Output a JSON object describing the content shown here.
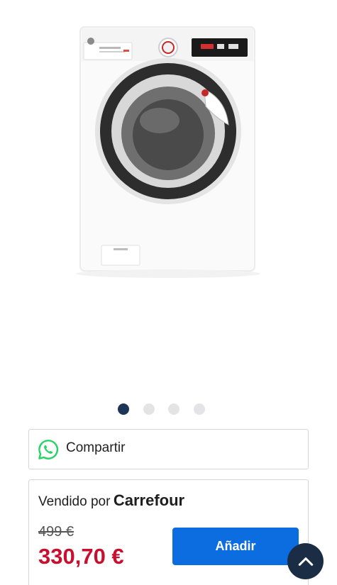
{
  "gallery": {
    "total_images": 4,
    "active_index": 0
  },
  "share": {
    "label": "Compartir",
    "icon": "whatsapp-icon",
    "icon_color": "#25D366"
  },
  "seller": {
    "prefix": "Vendido por",
    "name": "Carrefour"
  },
  "price": {
    "old": "499 €",
    "current": "330,70 €",
    "current_color": "#c8102e"
  },
  "buttons": {
    "add_label": "Añadir",
    "add_color": "#0b6ddf",
    "scroll_top_icon": "chevron-up-icon"
  }
}
